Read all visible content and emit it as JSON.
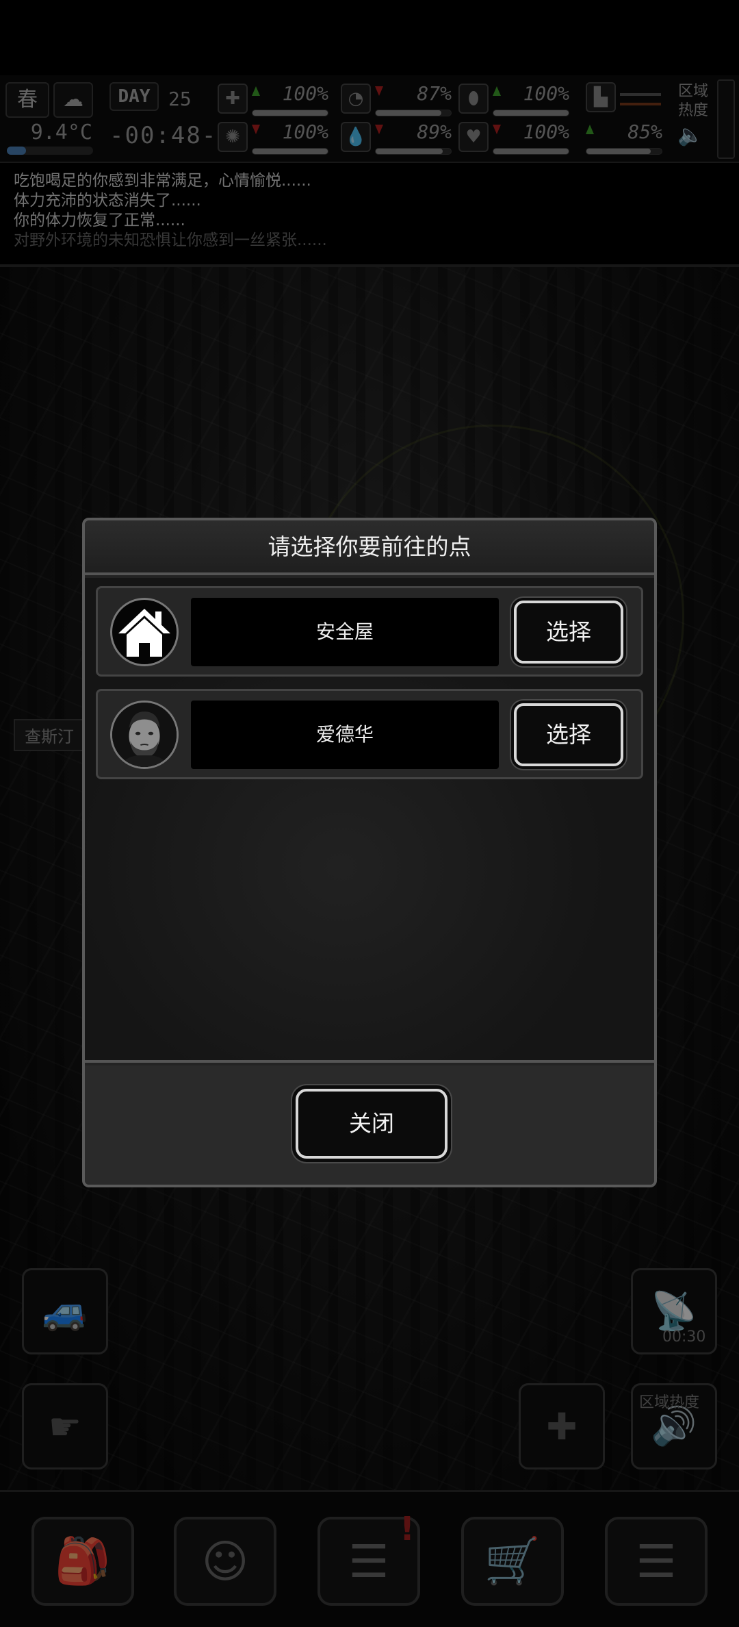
{
  "status_bar": {
    "season": "春",
    "temperature": "9.4°C",
    "day_label": "DAY",
    "day_number": "25",
    "clock": "-00:48-",
    "region_heat_label": "区域热度",
    "stats": [
      {
        "icon": "medkit-icon",
        "trend": "up",
        "value": "100%",
        "fill": 1.0
      },
      {
        "icon": "stomach-icon",
        "trend": "down",
        "value": "87%",
        "fill": 0.87
      },
      {
        "icon": "pill-icon",
        "trend": "up",
        "value": "100%",
        "fill": 1.0
      },
      {
        "icon": "brain-icon",
        "trend": "down",
        "value": "100%",
        "fill": 1.0
      },
      {
        "icon": "water-drop-icon",
        "trend": "down",
        "value": "89%",
        "fill": 0.89
      },
      {
        "icon": "heart-icon",
        "trend": "down",
        "value": "100%",
        "fill": 1.0
      },
      {
        "icon": "stamina-icon",
        "trend": "up",
        "value": "85%",
        "fill": 0.85
      }
    ]
  },
  "log": {
    "lines": [
      "吃饱喝足的你感到非常满足，心情愉悦......",
      "体力充沛的状态消失了......",
      "你的体力恢复了正常......",
      "对野外环境的未知恐惧让你感到一丝紧张......"
    ]
  },
  "map": {
    "location_label": "查斯汀"
  },
  "side_buttons": {
    "radio_timer": "00:30",
    "region_heat_label": "区域热度"
  },
  "dialog": {
    "title": "请选择你要前往的点",
    "destinations": [
      {
        "name": "安全屋",
        "select_label": "选择",
        "icon": "house-icon"
      },
      {
        "name": "爱德华",
        "select_label": "选择",
        "icon": "portrait-icon"
      }
    ],
    "close_label": "关闭"
  },
  "bottom_nav": {
    "items": [
      {
        "icon": "backpack-icon"
      },
      {
        "icon": "brain-head-icon"
      },
      {
        "icon": "journal-icon",
        "badge": "!"
      },
      {
        "icon": "shopping-cart-icon"
      },
      {
        "icon": "menu-list-icon"
      }
    ]
  }
}
